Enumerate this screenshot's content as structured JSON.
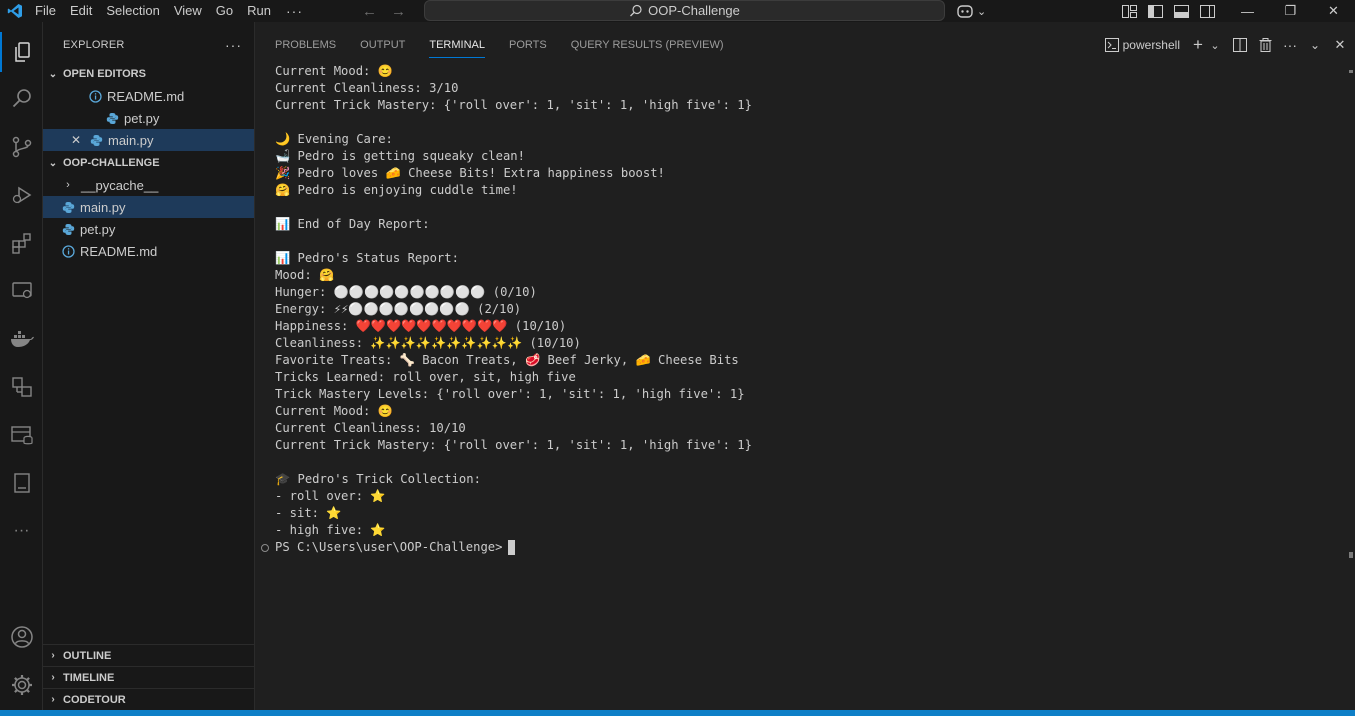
{
  "titlebar": {
    "menu": [
      "File",
      "Edit",
      "Selection",
      "View",
      "Go",
      "Run"
    ],
    "menu_more": "···",
    "search_text": "OOP-Challenge"
  },
  "sidebar": {
    "title": "EXPLORER",
    "more": "···",
    "open_editors": {
      "label": "OPEN EDITORS",
      "files": [
        {
          "name": "README.md",
          "icon": "info-icon"
        },
        {
          "name": "pet.py",
          "icon": "python-icon"
        },
        {
          "name": "main.py",
          "icon": "python-icon"
        }
      ]
    },
    "workspace": {
      "label": "OOP-CHALLENGE",
      "items": [
        {
          "name": "__pycache__",
          "type": "folder"
        },
        {
          "name": "main.py",
          "icon": "python-icon"
        },
        {
          "name": "pet.py",
          "icon": "python-icon"
        },
        {
          "name": "README.md",
          "icon": "info-icon"
        }
      ]
    },
    "bottom_sections": [
      "OUTLINE",
      "TIMELINE",
      "CODETOUR"
    ]
  },
  "panel": {
    "tabs": [
      "PROBLEMS",
      "OUTPUT",
      "TERMINAL",
      "PORTS",
      "QUERY RESULTS (PREVIEW)"
    ],
    "active_tab": "TERMINAL",
    "terminal_name": "powershell"
  },
  "terminal": {
    "lines": [
      "Current Mood: 😊",
      "Current Cleanliness: 3/10",
      "Current Trick Mastery: {'roll over': 1, 'sit': 1, 'high five': 1}",
      "",
      "🌙 Evening Care:",
      "🛁 Pedro is getting squeaky clean!",
      "🎉 Pedro loves 🧀 Cheese Bits! Extra happiness boost!",
      "🤗 Pedro is enjoying cuddle time!",
      "",
      "📊 End of Day Report:",
      "",
      "📊 Pedro's Status Report:",
      "Mood: 🤗",
      "Hunger: ⚪⚪⚪⚪⚪⚪⚪⚪⚪⚪ (0/10)",
      "Energy: ⚡⚡⚪⚪⚪⚪⚪⚪⚪⚪ (2/10)",
      "Happiness: ❤️❤️❤️❤️❤️❤️❤️❤️❤️❤️ (10/10)",
      "Cleanliness: ✨✨✨✨✨✨✨✨✨✨ (10/10)",
      "Favorite Treats: 🦴 Bacon Treats, 🥩 Beef Jerky, 🧀 Cheese Bits",
      "Tricks Learned: roll over, sit, high five",
      "Trick Mastery Levels: {'roll over': 1, 'sit': 1, 'high five': 1}",
      "Current Mood: 😊",
      "Current Cleanliness: 10/10",
      "Current Trick Mastery: {'roll over': 1, 'sit': 1, 'high five': 1}",
      "",
      "🎓 Pedro's Trick Collection:",
      "- roll over: ⭐",
      "- sit: ⭐",
      "- high five: ⭐"
    ],
    "prompt": "PS C:\\Users\\user\\OOP-Challenge>"
  },
  "colors": {
    "accent": "#0078d4",
    "statusbar": "#0e7fc7",
    "python_icon": "#5aa7d8",
    "info_icon": "#5aa7d8"
  }
}
